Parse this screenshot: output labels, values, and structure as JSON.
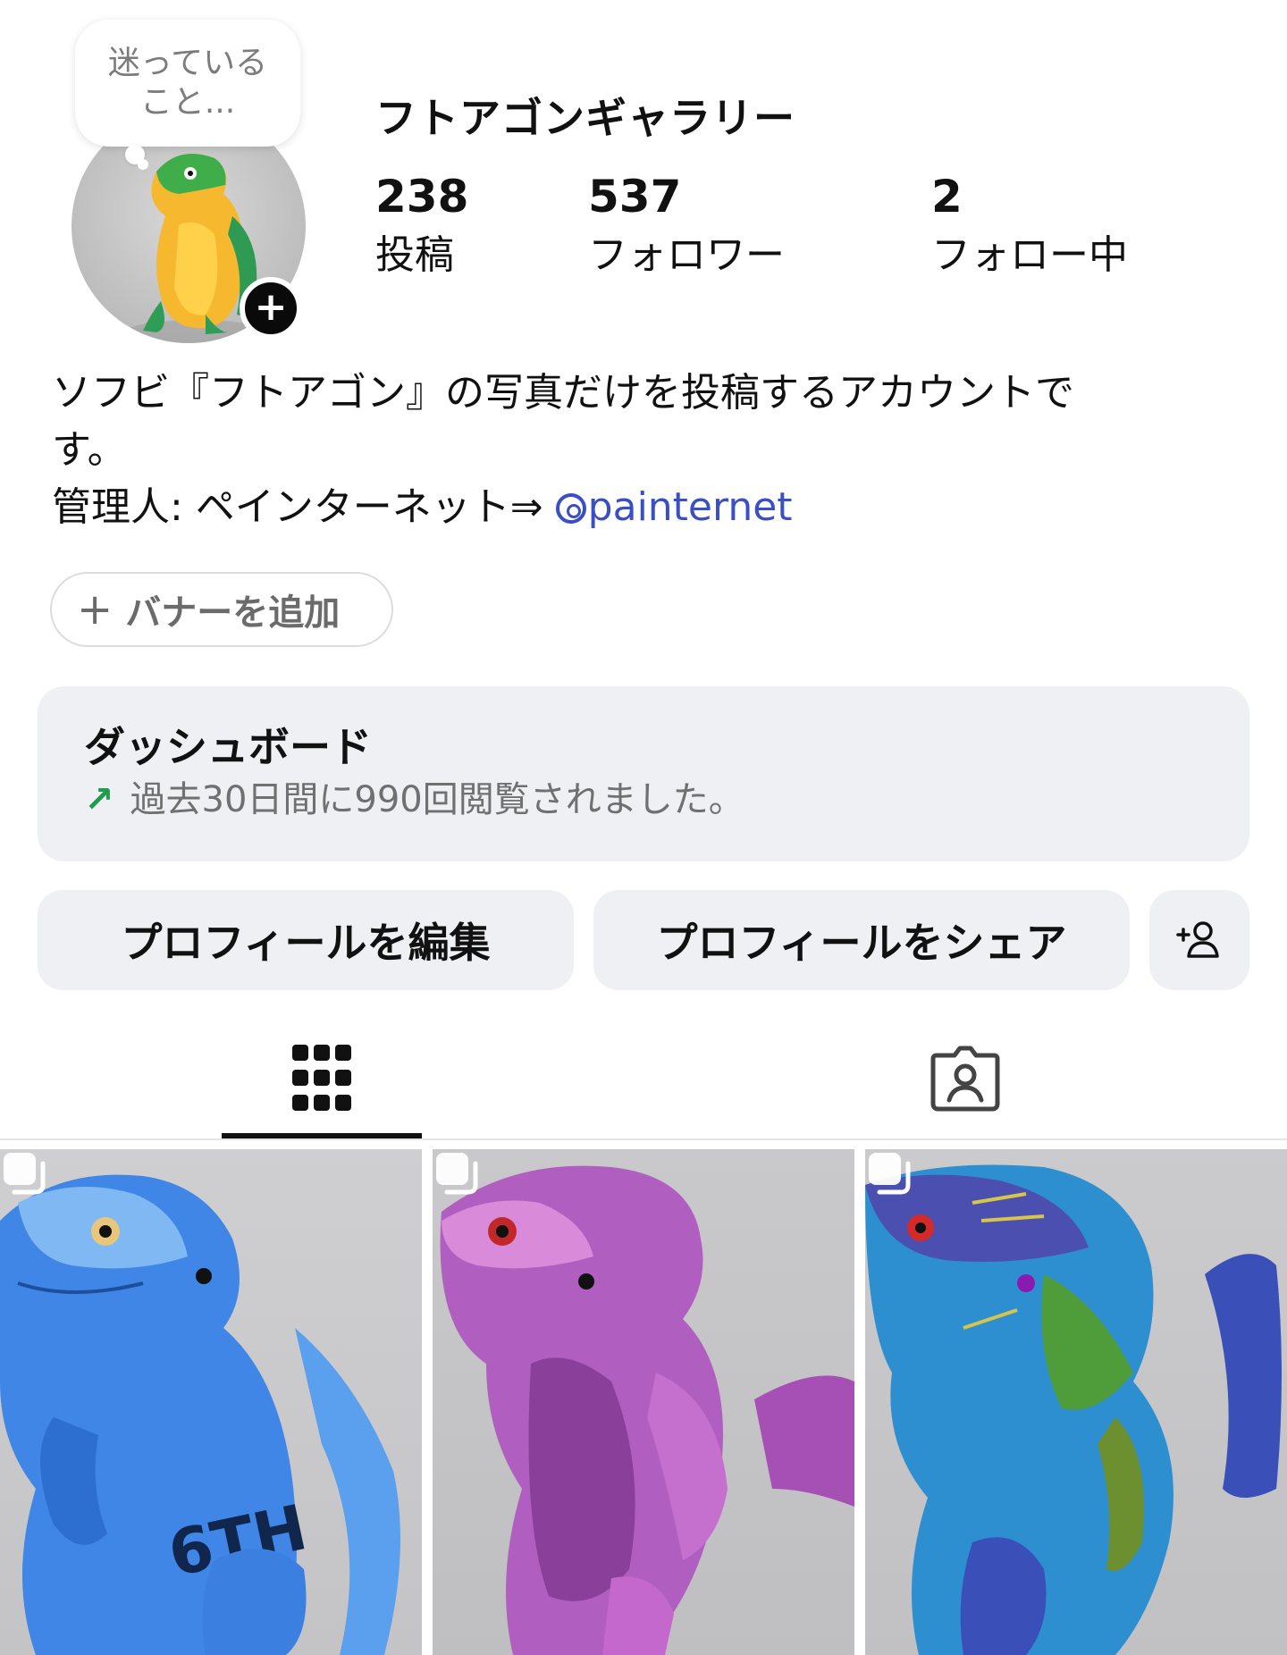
{
  "note": {
    "text": "迷っている\nこと..."
  },
  "profile": {
    "name": "フトアゴンギャラリー",
    "avatar_icon": "lizard-figure-avatar"
  },
  "stats": {
    "posts": {
      "count": "238",
      "label": "投稿"
    },
    "followers": {
      "count": "537",
      "label": "フォロワー"
    },
    "following": {
      "count": "2",
      "label": "フォロー中"
    }
  },
  "bio": {
    "line1": "ソフビ『フトアゴン』の写真だけを投稿するアカウントで",
    "line2": "す。",
    "line3_prefix": "管理人: ペインターネット⇒ ",
    "threads_handle": "painternet",
    "link_color": "#3b4fc4"
  },
  "banner": {
    "label": "バナーを追加"
  },
  "dashboard": {
    "title": "ダッシュボード",
    "subtitle": "過去30日間に990回閲覧されました。",
    "trend_color": "#1f9d4c"
  },
  "actions": {
    "edit_label": "プロフィールを編集",
    "share_label": "プロフィールをシェア"
  },
  "tabs": [
    {
      "icon": "grid-icon",
      "active": true
    },
    {
      "icon": "tagged-person-icon",
      "active": false
    }
  ],
  "posts": [
    {
      "description": "blue lizard figure",
      "carousel": true,
      "accent": "#3f86e6"
    },
    {
      "description": "metallic purple lizard figure",
      "carousel": true,
      "accent": "#b05fc0"
    },
    {
      "description": "glitter blue-green lizard figure",
      "carousel": true,
      "accent": "#2e8fd0"
    }
  ]
}
